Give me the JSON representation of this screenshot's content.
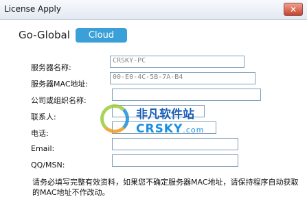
{
  "window": {
    "title": "License Apply",
    "close_symbol": "✕"
  },
  "logo": {
    "text": "Go-Global",
    "badge": "Cloud"
  },
  "form": {
    "server_name": {
      "label": "服务器名称:",
      "value": "CRSKY-PC"
    },
    "server_mac": {
      "label": "服务器MAC地址:",
      "value": "00-E0-4C-5B-7A-B4"
    },
    "company": {
      "label": "公司或组织名称:",
      "value": ""
    },
    "contact": {
      "label": "联系人:",
      "value": ""
    },
    "phone": {
      "label": "电话:",
      "value": ""
    },
    "email": {
      "label": "Email:",
      "value": ""
    },
    "qq_msn": {
      "label": "QQ/MSN:",
      "value": ""
    }
  },
  "notice": "请务必填写完整有效资料，如果您不确定服务器MAC地址，请保持程序自动获取的MAC地址不作改动。",
  "watermark": {
    "cn": "非凡软件站",
    "en": "CRSKY",
    "com": ".com"
  }
}
